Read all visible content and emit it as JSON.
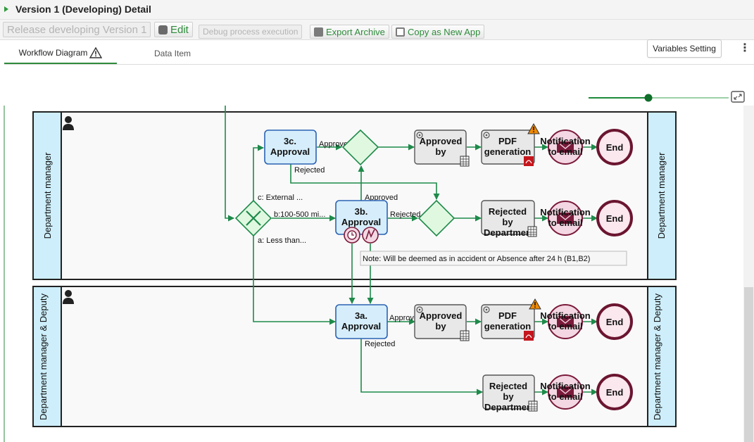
{
  "header": {
    "title": "Version 1 (Developing) Detail"
  },
  "toolbar": {
    "release_label": "Release developing Version 1",
    "edit_label": "Edit",
    "debug_label": "Debug process execution",
    "export_label": "Export Archive",
    "copy_label": "Copy as New App"
  },
  "tabs": [
    {
      "label": "Workflow Diagram"
    },
    {
      "label": "Data Item"
    }
  ],
  "actions": {
    "variables_label": "Variables Setting"
  },
  "colors": {
    "accent": "#2e8b3b",
    "lane_header": "#cdeefa",
    "task_fill": "#d6eefb",
    "task_border": "#2a62b3",
    "gateway_fill": "#e0f8e0",
    "event_border": "#7a1a3a",
    "warning": "#f08a00"
  },
  "diagram": {
    "lanes": [
      {
        "label": "Department manager"
      },
      {
        "label": "Department manager & Deputy"
      }
    ],
    "tasks": {
      "t3c": "3c. Approval",
      "t3b": "3b. Approval",
      "t3a": "3a. Approval"
    },
    "steps": {
      "approved_by_1": "Approved by",
      "pdf_1": "PDF generation",
      "notify_1": "Notification to email",
      "end_1": "End",
      "rejected_by_1": "Rejected by Departmen",
      "notify_2": "Notification to email",
      "end_2": "End",
      "approved_by_2": "Approved by",
      "pdf_2": "PDF generation",
      "notify_3": "Notification to email",
      "end_3": "End",
      "rejected_by_2": "Rejected by Departmen",
      "notify_4": "Notification to email",
      "end_4": "End"
    },
    "flow_labels": {
      "approved_3c": "Approved",
      "rejected_3c": "Rejected",
      "approved_3b": "Approved",
      "rejected_3b": "Rejected",
      "branch_c": "c: External ...",
      "branch_b": "b:100-500 mi...",
      "branch_a": "a: Less than...",
      "approved_3a": "Approved",
      "rejected_3a": "Rejected"
    },
    "note": "Note: Will be deemed as in accident or Absence after 24 h (B1,B2)"
  },
  "icons": {
    "title_marker": "expand-triangle-icon",
    "edit": "pencil-icon",
    "export": "download-icon",
    "copy": "copy-icon",
    "tab_warning": "warning-icon",
    "more": "kebab-menu-icon",
    "fit": "fit-screen-icon",
    "lane_user": "user-icon",
    "timer": "timer-icon",
    "error": "error-icon",
    "pdf": "pdf-icon",
    "mail": "mail-icon",
    "service": "gear-icon",
    "table": "table-icon"
  },
  "zoom": {
    "level": 0.72
  }
}
